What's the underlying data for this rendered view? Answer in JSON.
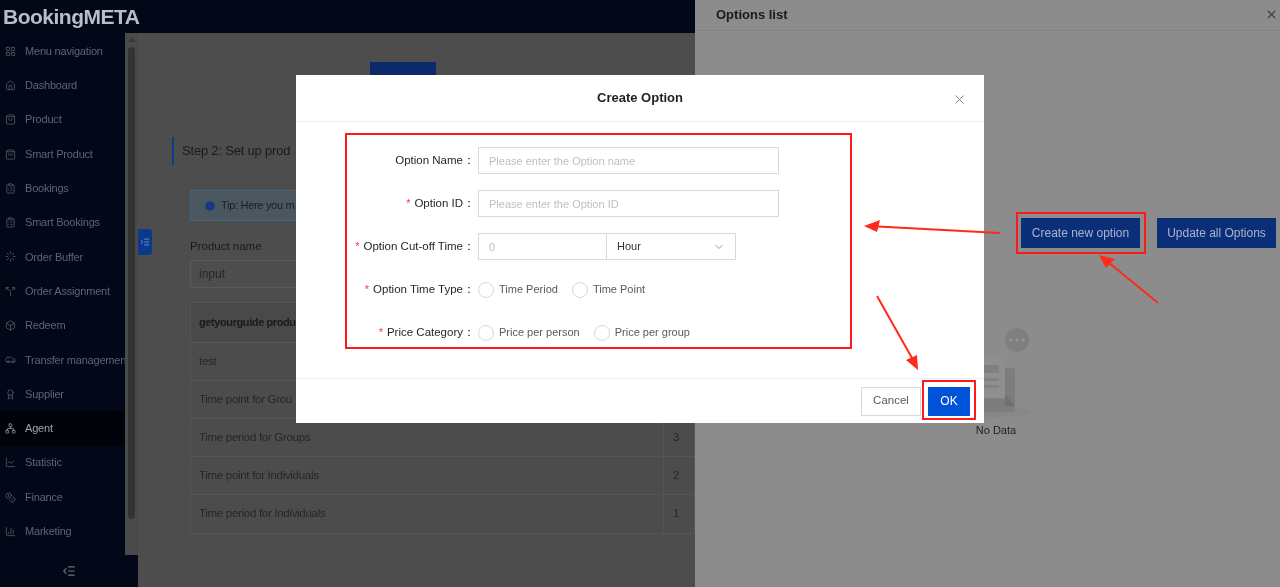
{
  "header": {
    "logo": "BookingMETA"
  },
  "sidebar": {
    "items": [
      {
        "label": "Menu navigation",
        "selected": false
      },
      {
        "label": "Dashboard",
        "selected": false
      },
      {
        "label": "Product",
        "selected": false
      },
      {
        "label": "Smart Product",
        "selected": false
      },
      {
        "label": "Bookings",
        "selected": false
      },
      {
        "label": "Smart Bookings",
        "selected": false
      },
      {
        "label": "Order Buffer",
        "selected": false
      },
      {
        "label": "Order Assignment",
        "selected": false
      },
      {
        "label": "Redeem",
        "selected": false
      },
      {
        "label": "Transfer managemen",
        "selected": false
      },
      {
        "label": "Supplier",
        "selected": false
      },
      {
        "label": "Agent",
        "selected": true
      },
      {
        "label": "Statistic",
        "selected": false
      },
      {
        "label": "Finance",
        "selected": false
      },
      {
        "label": "Marketing",
        "selected": false
      }
    ]
  },
  "main": {
    "step_title": "Step 2: Set up prod",
    "tip": "Tip: Here you m",
    "product_name": {
      "label": "Product name",
      "placeholder": "input"
    },
    "table": {
      "header": "getyourguide produ",
      "rows": [
        {
          "name": "test"
        },
        {
          "name": "Time point for Grou"
        },
        {
          "name": "Time period for Groups",
          "count": "3"
        },
        {
          "name": "Time point for Individuals",
          "count": "2"
        },
        {
          "name": "Time period for Individuals",
          "count": "1"
        }
      ]
    }
  },
  "drawer": {
    "title": "Options list",
    "buttons": [
      "Create new option",
      "Update all Options"
    ],
    "empty_text": "No Data"
  },
  "modal": {
    "title": "Create Option",
    "required_mark": "*",
    "fields": [
      {
        "kind": "text",
        "label": "Option Name：",
        "required": false,
        "placeholder": "Please enter the Option name"
      },
      {
        "kind": "text",
        "label": "Option ID：",
        "required": true,
        "placeholder": "Please enter the Option ID"
      },
      {
        "kind": "number_unit",
        "label": "Option Cut-off Time：",
        "required": true,
        "placeholder": "0",
        "unit": "Hour"
      },
      {
        "kind": "radio",
        "label": "Option Time Type：",
        "required": true,
        "options": [
          {
            "label": "Time Period",
            "selected": false
          },
          {
            "label": "Time Point",
            "selected": false
          }
        ]
      },
      {
        "kind": "radio",
        "label": "Price Category：",
        "required": true,
        "options": [
          {
            "label": "Price per person",
            "selected": false
          },
          {
            "label": "Price per group",
            "selected": false
          }
        ]
      }
    ],
    "cancel": "Cancel",
    "ok": "OK"
  }
}
